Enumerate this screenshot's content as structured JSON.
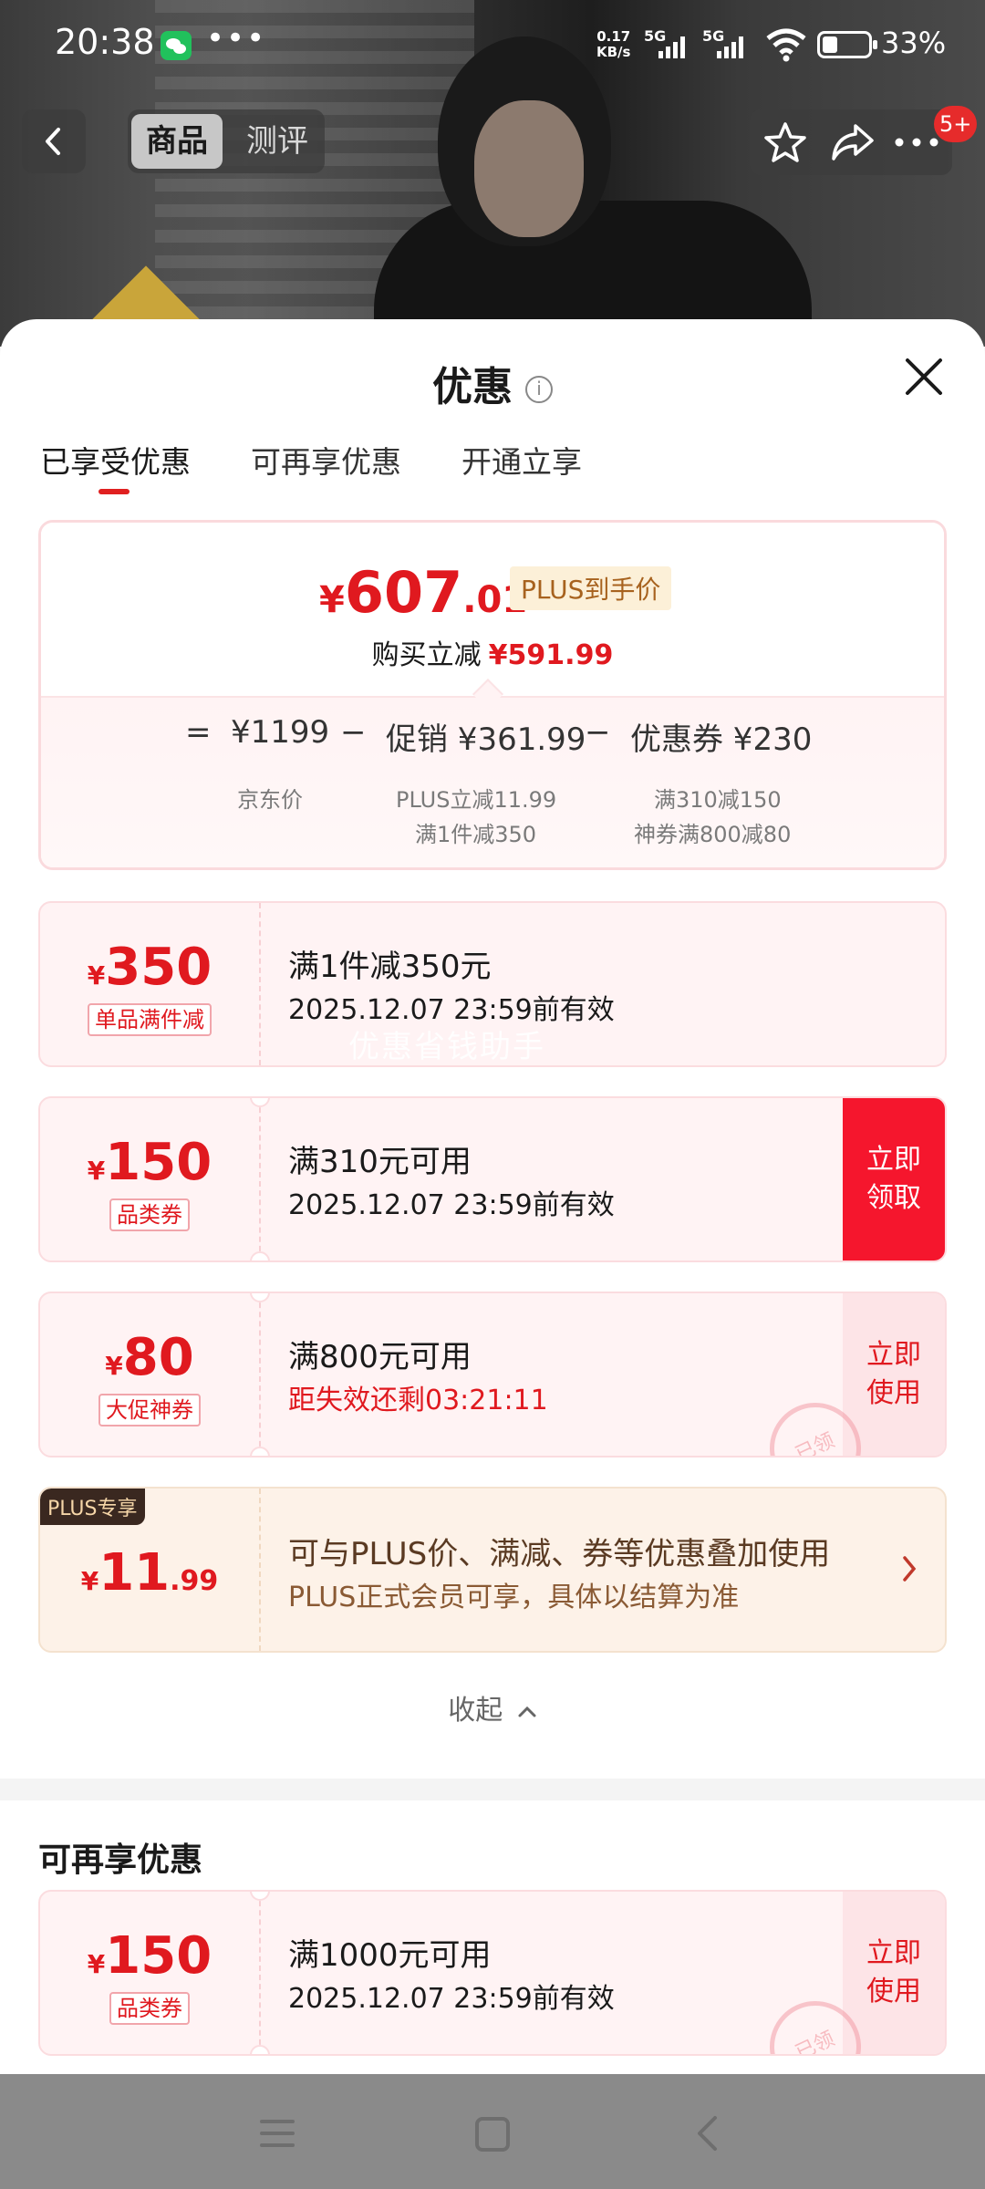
{
  "status_bar": {
    "time": "20:38",
    "net_speed_value": "0.17",
    "net_speed_unit": "KB/s",
    "sim1": "5G",
    "sim2": "5G",
    "battery_percent": "33%",
    "battery_level": 0.33,
    "icons": [
      "wechat-icon",
      "more-dots-icon",
      "signal-icon",
      "wifi-icon",
      "battery-icon"
    ]
  },
  "top_nav": {
    "tab_product": "商品",
    "tab_review": "测评",
    "badge": "5+",
    "icons": [
      "back-icon",
      "star-icon",
      "share-icon",
      "more-icon"
    ]
  },
  "sheet": {
    "title": "优惠",
    "tabs": [
      "已享受优惠",
      "可再享优惠",
      "开通立享"
    ],
    "active_tab": 0
  },
  "summary": {
    "price_symbol": "¥",
    "price_int": "607",
    "price_dec": ".01",
    "plus_tag": "PLUS到手价",
    "buy_reduce_label": "购买立减",
    "buy_reduce_value": "¥591.99",
    "eq": "=",
    "jd_price": "¥1199",
    "jd_price_label": "京东价",
    "minus1": "−",
    "promo": "促销 ¥361.99",
    "promo_sub1": "PLUS立减11.99",
    "promo_sub2": "满1件减350",
    "minus2": "−",
    "coupon": "优惠券 ¥230",
    "coupon_sub1": "满310减150",
    "coupon_sub2": "神券满800减80"
  },
  "coupons": [
    {
      "symbol": "¥",
      "amount": "350",
      "kind": "单品满件减",
      "title": "满1件减350元",
      "sub": "2025.12.07 23:59前有效",
      "action": ""
    },
    {
      "symbol": "¥",
      "amount": "150",
      "kind": "品类券",
      "title": "满310元可用",
      "sub": "2025.12.07 23:59前有效",
      "action": "立即领取"
    },
    {
      "symbol": "¥",
      "amount": "80",
      "kind": "大促神券",
      "title": "满800元可用",
      "sub": "距失效还剩03:21:11",
      "action": "立即使用",
      "stamp": "已领"
    }
  ],
  "watermark": "优惠省钱助手",
  "plus_card": {
    "tag": "PLUS专享",
    "symbol": "¥",
    "amount_int": "11",
    "amount_dec": ".99",
    "title": "可与PLUS价、满减、券等优惠叠加使用",
    "sub": "PLUS正式会员可享，具体以结算为准"
  },
  "collapse_label": "收起",
  "section2": {
    "title": "可再享优惠",
    "coupon": {
      "symbol": "¥",
      "amount": "150",
      "kind": "品类券",
      "title": "满1000元可用",
      "sub": "2025.12.07 23:59前有效",
      "action": "立即使用",
      "stamp": "已领"
    }
  },
  "navbar": {
    "icons": [
      "menu-icon",
      "home-icon",
      "back-nav-icon"
    ]
  },
  "colors": {
    "accent_red": "#e0191f",
    "button_red": "#f5162d",
    "plus_brown": "#5a3a22"
  }
}
